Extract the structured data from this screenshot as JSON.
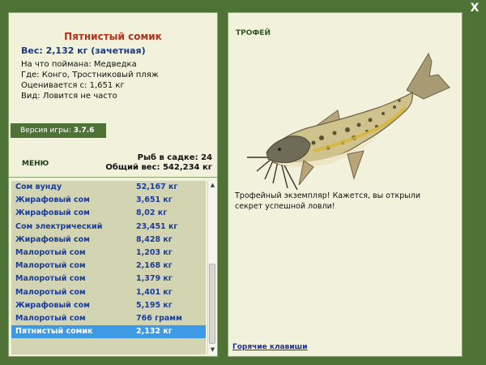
{
  "window": {
    "close_label": "X"
  },
  "fish_info": {
    "title": "Пятнистый сомик",
    "weight_line": "Вес: 2,132 кг (зачетная)",
    "lines": [
      "На что поймана: Медведка",
      "Где: Конго, Тростниковый пляж",
      "Оценивается с: 1,651 кг",
      "Вид: Ловится не часто"
    ]
  },
  "version": {
    "label": "Версия игры:",
    "value": "3.7.6"
  },
  "menu": {
    "label": "МЕНЮ"
  },
  "catch_stats": {
    "count_line": "Рыб в садке: 24",
    "total_line": "Общий вес: 542,234 кг"
  },
  "catch_list": [
    {
      "name": "Сом вунду",
      "weight": "52,167 кг"
    },
    {
      "name": "Жирафовый сом",
      "weight": "3,651 кг"
    },
    {
      "name": "Жирафовый сом",
      "weight": "8,02 кг"
    },
    {
      "name": "Сом электрический",
      "weight": "23,451 кг"
    },
    {
      "name": "Жирафовый сом",
      "weight": "8,428 кг"
    },
    {
      "name": "Малоротый сом",
      "weight": "1,203 кг"
    },
    {
      "name": "Малоротый сом",
      "weight": "2,168 кг"
    },
    {
      "name": "Малоротый сом",
      "weight": "1,379 кг"
    },
    {
      "name": "Малоротый сом",
      "weight": "1,401 кг"
    },
    {
      "name": "Жирафовый сом",
      "weight": "5,195 кг"
    },
    {
      "name": "Малоротый сом",
      "weight": "766 грамм"
    },
    {
      "name": "Пятнистый сомик",
      "weight": "2,132 кг",
      "selected": true
    }
  ],
  "trophy": {
    "label": "ТРОФЕЙ",
    "message": "Трофейный экземпляр! Кажется, вы открыли секрет успешной ловли!"
  },
  "links": {
    "hotkeys": "Горячие клавиши"
  },
  "colors": {
    "background": "#4f7336",
    "panel": "#f1f1dc",
    "title": "#b2321c",
    "list_text": "#1b3d9a",
    "selection": "#3f9ae6"
  }
}
